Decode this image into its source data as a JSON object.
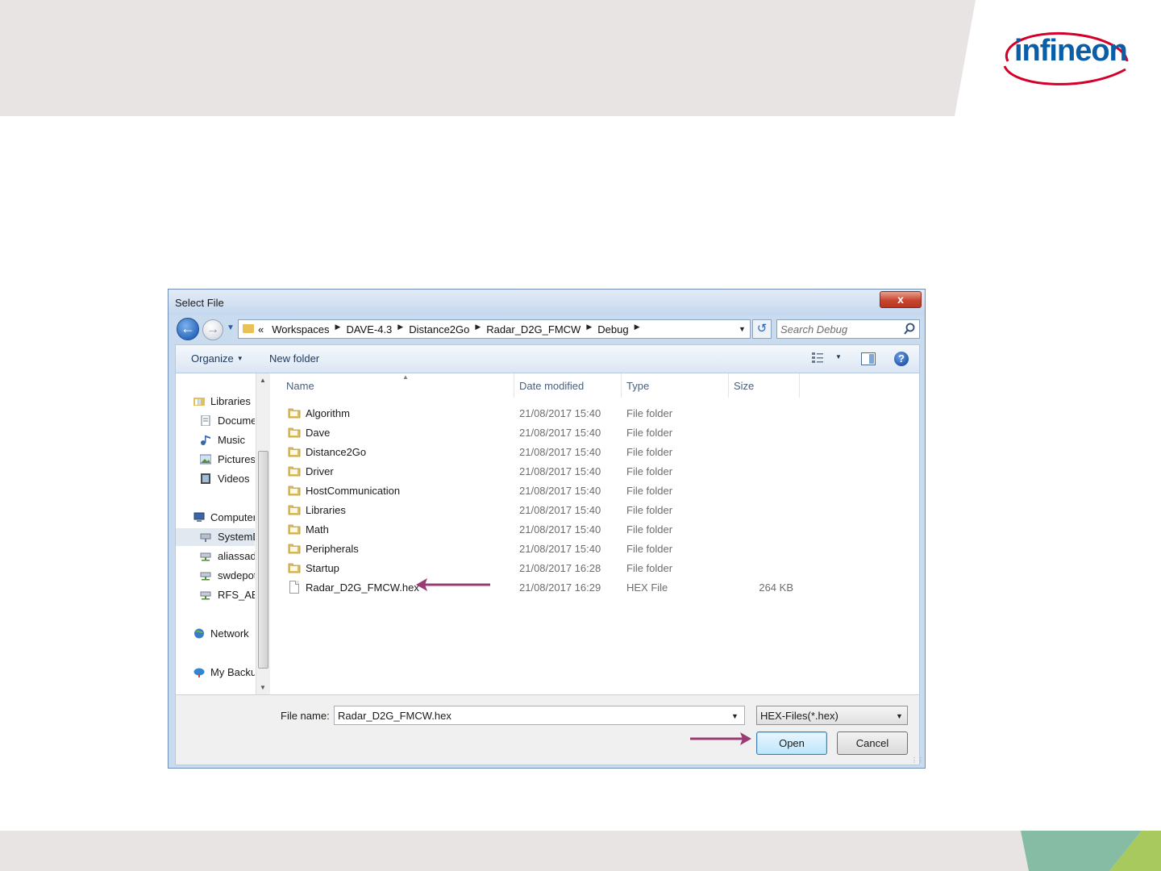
{
  "slide": {
    "logo_text": "infineon",
    "colors": {
      "band": "#e8e4e4",
      "accent_green": "#86bba4",
      "accent_lime": "#a7c95d",
      "arrow": "#9b3b76",
      "logo_blue": "#0a5ea8",
      "logo_red": "#d4002a"
    }
  },
  "dialog": {
    "title": "Select File",
    "close_label": "x",
    "address": {
      "overflow": "«",
      "crumbs": [
        "Workspaces",
        "DAVE-4.3",
        "Distance2Go",
        "Radar_D2G_FMCW",
        "Debug"
      ]
    },
    "search": {
      "placeholder": "Search Debug"
    },
    "toolbar": {
      "organize": "Organize",
      "new_folder": "New folder"
    },
    "nav": {
      "items": [
        {
          "label": "Libraries",
          "icon": "libraries-icon"
        },
        {
          "label": "Documents",
          "icon": "documents-icon"
        },
        {
          "label": "Music",
          "icon": "music-icon"
        },
        {
          "label": "Pictures",
          "icon": "pictures-icon"
        },
        {
          "label": "Videos",
          "icon": "videos-icon"
        },
        {
          "label": "Computer",
          "icon": "computer-icon"
        },
        {
          "label": "SystemDrive",
          "icon": "drive-icon"
        },
        {
          "label": "aliassad",
          "icon": "network-drive-icon"
        },
        {
          "label": "swdepot",
          "icon": "network-drive-icon"
        },
        {
          "label": "RFS_AE_",
          "icon": "network-drive-icon"
        },
        {
          "label": "Network",
          "icon": "network-icon"
        },
        {
          "label": "My Backup",
          "icon": "backup-icon"
        }
      ]
    },
    "columns": {
      "name": "Name",
      "date": "Date modified",
      "type": "Type",
      "size": "Size"
    },
    "files": [
      {
        "name": "Algorithm",
        "date": "21/08/2017 15:40",
        "type": "File folder",
        "size": ""
      },
      {
        "name": "Dave",
        "date": "21/08/2017 15:40",
        "type": "File folder",
        "size": ""
      },
      {
        "name": "Distance2Go",
        "date": "21/08/2017 15:40",
        "type": "File folder",
        "size": ""
      },
      {
        "name": "Driver",
        "date": "21/08/2017 15:40",
        "type": "File folder",
        "size": ""
      },
      {
        "name": "HostCommunication",
        "date": "21/08/2017 15:40",
        "type": "File folder",
        "size": ""
      },
      {
        "name": "Libraries",
        "date": "21/08/2017 15:40",
        "type": "File folder",
        "size": ""
      },
      {
        "name": "Math",
        "date": "21/08/2017 15:40",
        "type": "File folder",
        "size": ""
      },
      {
        "name": "Peripherals",
        "date": "21/08/2017 15:40",
        "type": "File folder",
        "size": ""
      },
      {
        "name": "Startup",
        "date": "21/08/2017 16:28",
        "type": "File folder",
        "size": ""
      },
      {
        "name": "Radar_D2G_FMCW.hex",
        "date": "21/08/2017 16:29",
        "type": "HEX File",
        "size": "264 KB"
      }
    ],
    "filename": {
      "label": "File name:",
      "value": "Radar_D2G_FMCW.hex"
    },
    "filter": {
      "value": "HEX-Files(*.hex)"
    },
    "buttons": {
      "open": "Open",
      "cancel": "Cancel"
    }
  }
}
